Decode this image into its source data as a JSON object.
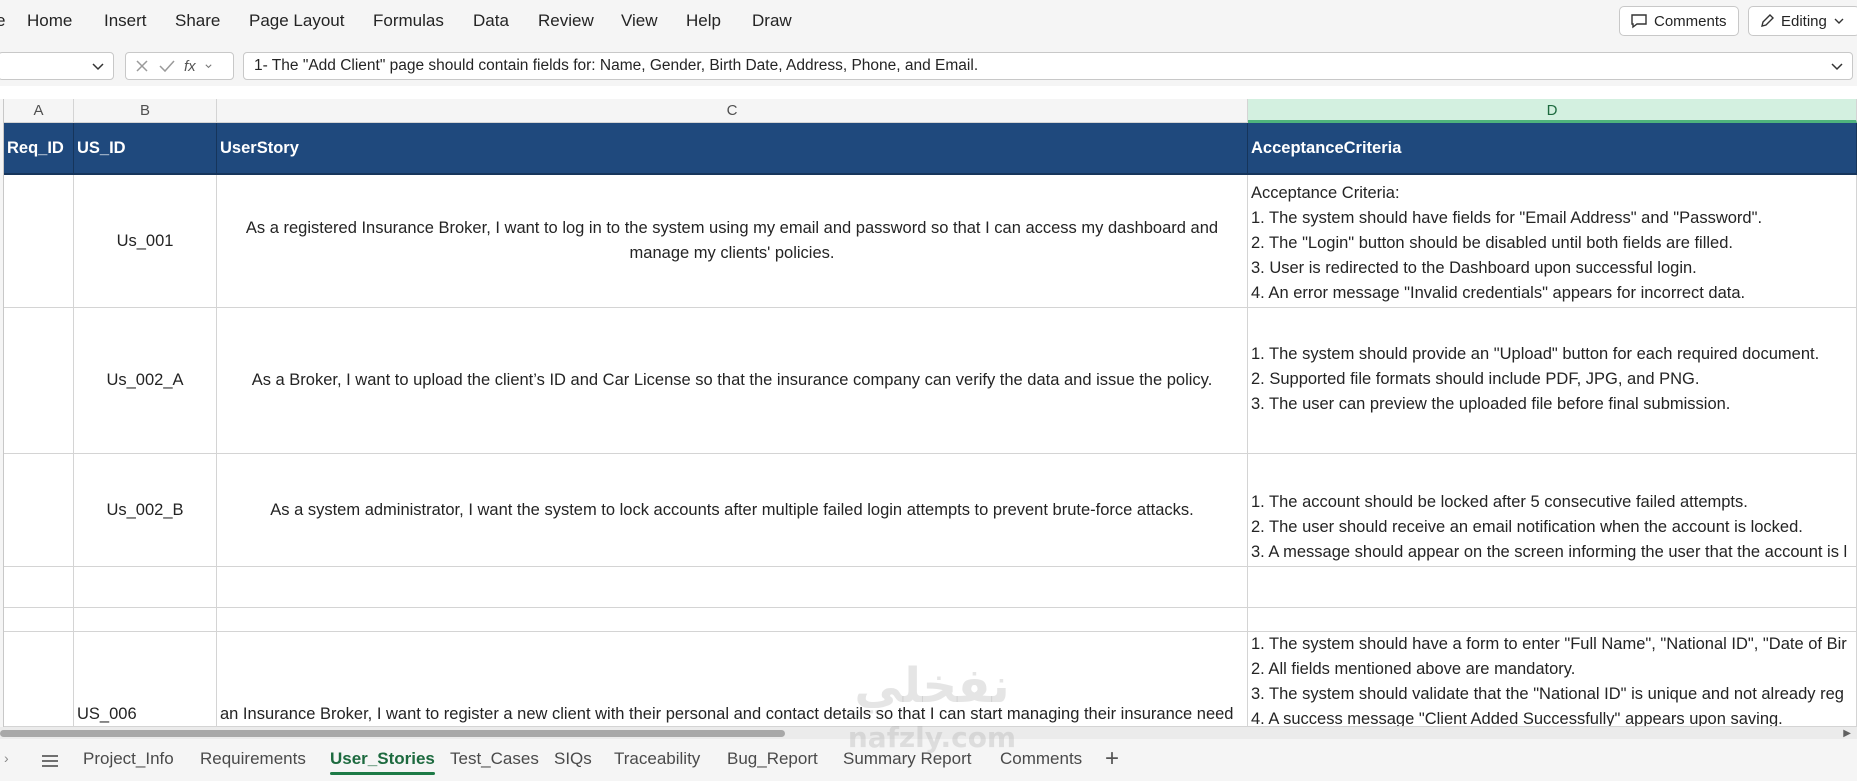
{
  "ribbon": {
    "cut_label": "e",
    "tabs": [
      "Home",
      "Insert",
      "Share",
      "Page Layout",
      "Formulas",
      "Data",
      "Review",
      "View",
      "Help",
      "Draw"
    ],
    "comments_label": "Comments",
    "editing_label": "Editing"
  },
  "formula_bar": {
    "name_box": "",
    "fx_label": "fx",
    "value": "1- The \"Add Client\" page should contain fields for: Name, Gender, Birth Date, Address, Phone, and Email."
  },
  "columns": [
    "A",
    "B",
    "C",
    "D"
  ],
  "selected_column": "D",
  "table": {
    "headers": [
      "Req_ID",
      "US_ID",
      "UserStory",
      "AcceptanceCriteria"
    ],
    "rows": [
      {
        "req_id": "",
        "us_id": "Us_001",
        "story": "As a registered Insurance Broker, I want to log in to the system using my email and password so that I can access my dashboard and manage my clients' policies.",
        "criteria": [
          "Acceptance Criteria:",
          "1. The system should have fields for \"Email Address\" and \"Password\".",
          "2. The \"Login\" button should be disabled until both fields are filled.",
          "3. User is redirected to the Dashboard upon successful login.",
          "4. An error message \"Invalid credentials\" appears for incorrect data."
        ]
      },
      {
        "req_id": "",
        "us_id": "Us_002_A",
        "story": "As a Broker, I want to upload the client’s ID and Car License so that the insurance company can verify the data and issue the policy.",
        "criteria": [
          "1. The system should provide an \"Upload\" button for each required document.",
          "2. Supported file formats should include PDF, JPG, and PNG.",
          "3. The user can preview the uploaded file before final submission."
        ]
      },
      {
        "req_id": "",
        "us_id": "Us_002_B",
        "story": "As a system administrator, I want the system to lock accounts after multiple failed login attempts to prevent brute-force attacks.",
        "criteria": [
          "1. The account should be locked after 5 consecutive failed attempts.",
          "2. The user should receive an email notification when the account is locked.",
          "3. A message should appear on the screen informing the user that the account is l"
        ]
      },
      {
        "req_id": "",
        "us_id": "US_006",
        "story": "an Insurance Broker, I want to register a new client with their personal and contact details so that I can start managing their insurance need",
        "criteria": [
          "1. The system should have a form to enter \"Full Name\", \"National ID\", \"Date of Bir",
          "2. All fields mentioned above are mandatory.",
          "3. The system should validate that the \"National ID\" is unique and not already reg",
          "4. A success message \"Client Added Successfully\" appears upon saving."
        ]
      }
    ]
  },
  "sheet_tabs": [
    "Project_Info",
    "Requirements",
    "User_Stories",
    "Test_Cases",
    "SIQs",
    "Traceability",
    "Bug_Report",
    "Summary Report",
    "Comments"
  ],
  "active_sheet": "User_Stories",
  "watermark": {
    "line1": "نفخلي",
    "line2": "nafzly.com"
  }
}
